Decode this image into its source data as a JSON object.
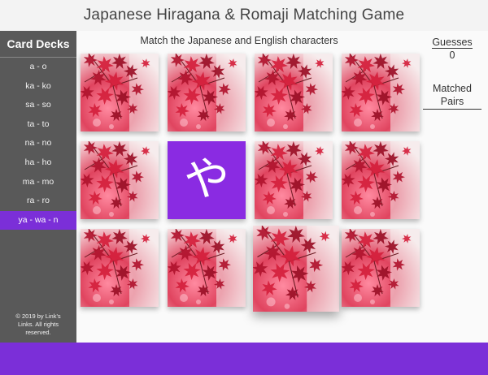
{
  "header": {
    "title": "Japanese Hiragana & Romaji Matching Game"
  },
  "sidebar": {
    "title": "Card Decks",
    "decks": [
      "a - o",
      "ka - ko",
      "sa - so",
      "ta - to",
      "na - no",
      "ha - ho",
      "ma - mo",
      "ra - ro",
      "ya - wa - n"
    ],
    "active_index": 8,
    "footer": "© 2019 by Link's Links. All rights reserved."
  },
  "main": {
    "instruction": "Match the Japanese and English characters",
    "guesses_label": "Guesses",
    "guesses_value": "0",
    "matched_label": "Matched Pairs"
  },
  "cards": [
    {
      "state": "back"
    },
    {
      "state": "back"
    },
    {
      "state": "back"
    },
    {
      "state": "back"
    },
    {
      "state": "back"
    },
    {
      "state": "face",
      "glyph": "や"
    },
    {
      "state": "back"
    },
    {
      "state": "back"
    },
    {
      "state": "back"
    },
    {
      "state": "back"
    },
    {
      "state": "back",
      "lifted": true
    },
    {
      "state": "back"
    }
  ],
  "colors": {
    "accent": "#7b2fd8",
    "sidebar_bg": "#595959",
    "card_face": "#8a2be2",
    "card_back": "#d43a5a"
  },
  "icons": {
    "card_back_image": "red-maple-leaves-image"
  }
}
